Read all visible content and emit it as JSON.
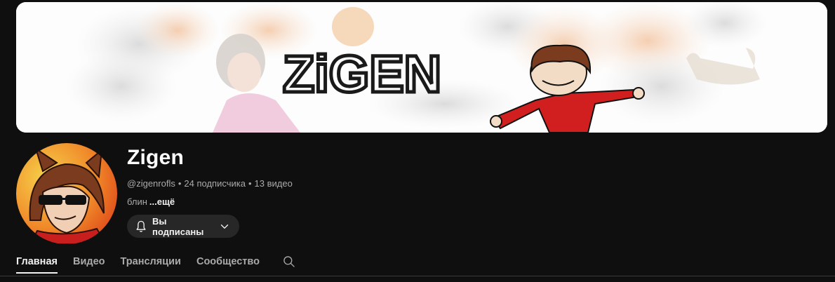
{
  "banner": {
    "logo_text": "ZiGEN"
  },
  "channel": {
    "name": "Zigen",
    "handle": "@zigenrofls",
    "subscribers": "24 подписчика",
    "videos": "13 видео",
    "separator": "•",
    "description": "блин",
    "more_label": "...ещё"
  },
  "subscribe_button": {
    "label": "Вы подписаны"
  },
  "tabs": [
    {
      "label": "Главная",
      "active": true
    },
    {
      "label": "Видео",
      "active": false
    },
    {
      "label": "Трансляции",
      "active": false
    },
    {
      "label": "Сообщество",
      "active": false
    }
  ],
  "colors": {
    "background": "#0f0f0f",
    "button_bg": "#272727",
    "text_primary": "#f1f1f1",
    "text_secondary": "#aaaaaa"
  },
  "icons": {
    "bell": "bell-icon",
    "chevron": "chevron-down-icon",
    "search": "search-icon"
  }
}
